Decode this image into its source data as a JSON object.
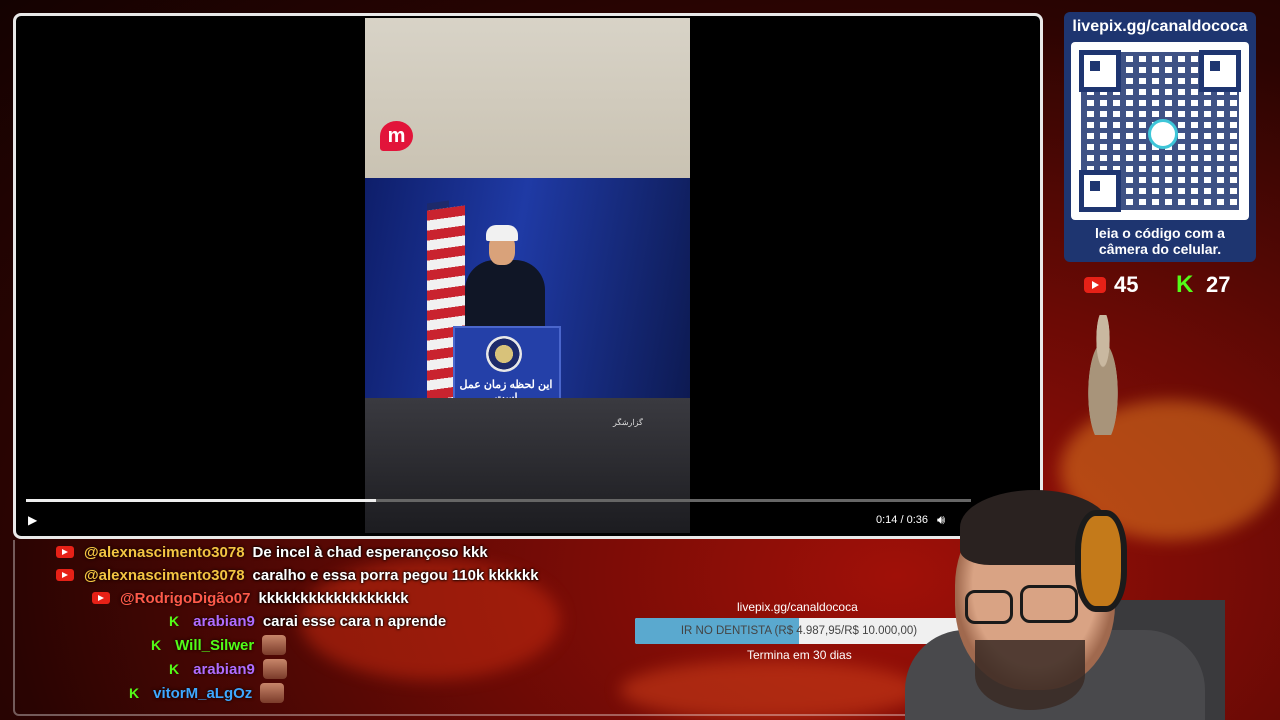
{
  "video": {
    "caption_farsi": "این لحظه زمان عمل است",
    "watermark": "گزارشگر",
    "logo_letter": "m",
    "time": "0:14 / 0:36",
    "progress": 0.37
  },
  "qr_panel": {
    "url": "livepix.gg/canaldococa",
    "caption_line1": "leia o código com a",
    "caption_line2": "câmera do celular."
  },
  "stats": {
    "youtube_count": "45",
    "kick_count": "27"
  },
  "chat": [
    {
      "platform": "youtube",
      "user": "@alexnascimento3078",
      "color": "#f4c542",
      "message": "De incel à chad esperançoso kkk"
    },
    {
      "platform": "youtube",
      "user": "@alexnascimento3078",
      "color": "#f4c542",
      "message": "caralho e essa porra pegou 110k kkkkkk"
    },
    {
      "platform": "youtube",
      "user": "@RodrigoDigão07",
      "color": "#ff5a4a",
      "message": "kkkkkkkkkkkkkkkkkk"
    },
    {
      "platform": "kick",
      "user": "arabian9",
      "color": "#b06cff",
      "message": "carai esse cara n aprende"
    },
    {
      "platform": "kick",
      "user": "Will_Silwer",
      "color": "#53fc18",
      "message": ""
    },
    {
      "platform": "kick",
      "user": "arabian9",
      "color": "#b06cff",
      "message": ""
    },
    {
      "platform": "kick",
      "user": "vitorM_aLgOz",
      "color": "#3ea8ff",
      "message": ""
    }
  ],
  "goal": {
    "url": "livepix.gg/canaldococa",
    "label": "IR NO DENTISTA (R$ 4.987,95/R$ 10.000,00)",
    "fraction": 0.4988,
    "deadline": "Termina em 30 dias"
  },
  "colors": {
    "youtube_red": "#e62117",
    "kick_green": "#53fc18",
    "qr_blue": "#1e3570",
    "goal_fill": "#5aa9cf"
  }
}
